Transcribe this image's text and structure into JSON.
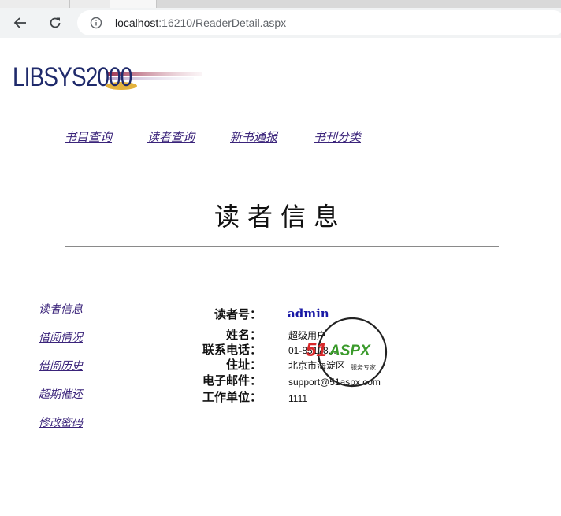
{
  "browser": {
    "back_icon": "arrow-left-icon",
    "reload_icon": "reload-icon",
    "info_icon": "info-icon",
    "url_host": "localhost",
    "url_rest": ":16210/ReaderDetail.aspx"
  },
  "logo": {
    "text": "LIBSYS2000"
  },
  "top_nav": [
    {
      "label": "书目查询"
    },
    {
      "label": "读者查询"
    },
    {
      "label": "新书通报"
    },
    {
      "label": "书刊分类"
    }
  ],
  "page_title": "读者信息",
  "side_nav": [
    {
      "label": "读者信息"
    },
    {
      "label": "借阅情况"
    },
    {
      "label": "借阅历史"
    },
    {
      "label": "超期催还"
    },
    {
      "label": "修改密码"
    }
  ],
  "reader": {
    "id_label": "读者号：",
    "id_value": "admin",
    "name_label": "姓名：",
    "name_value": "超级用户",
    "phone_label": "联系电话：",
    "phone_value": "01-85178...",
    "address_label": "住址：",
    "address_value": "北京市海淀区",
    "email_label": "电子邮件：",
    "email_value": "support@51aspx.com",
    "work_label": "工作单位：",
    "work_value": "1111"
  },
  "watermark": {
    "brand_red": "51",
    "brand_green": "ASPX",
    "tagline": "服务专家"
  },
  "colors": {
    "link": "#3a237a",
    "id_value": "#1a1aa6",
    "logo": "#1f2a6b"
  }
}
